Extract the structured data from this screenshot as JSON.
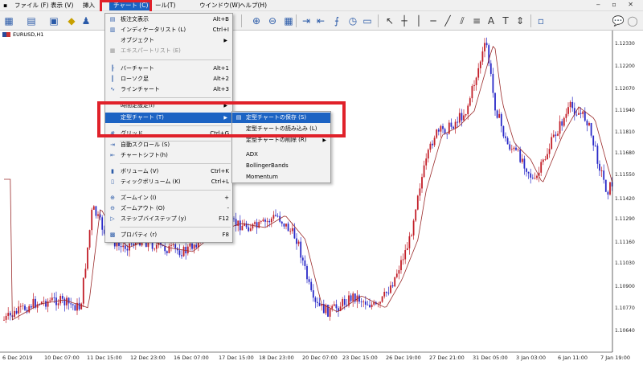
{
  "menubar": {
    "items": [
      {
        "label": "ファイル (F)"
      },
      {
        "label": "表示 (V)"
      },
      {
        "label": "挿入"
      },
      {
        "label": "チャート (C)"
      },
      {
        "label": "ール(T)"
      },
      {
        "label": "ウインドウ(W)"
      },
      {
        "label": "ヘルプ(H)"
      }
    ]
  },
  "symbol": "EURUSD,H1",
  "chart_menu": {
    "items": [
      {
        "label": "板注文表示",
        "shortcut": "Alt+B"
      },
      {
        "label": "インディケータリスト (L)",
        "shortcut": "Ctrl+I"
      },
      {
        "label": "オブジェクト",
        "shortcut": ""
      },
      {
        "label": "エキスパートリスト (E)",
        "shortcut": ""
      },
      {
        "label": "バーチャート",
        "shortcut": "Alt+1"
      },
      {
        "label": "ローソク足",
        "shortcut": "Alt+2"
      },
      {
        "label": "ラインチャート",
        "shortcut": "Alt+3"
      },
      {
        "label": "時間足設定(I)",
        "shortcut": ""
      },
      {
        "label": "定型チャート (T)",
        "shortcut": ""
      },
      {
        "label": "グリッド",
        "shortcut": "Ctrl+G"
      },
      {
        "label": "自動スクロール (S)",
        "shortcut": ""
      },
      {
        "label": "チャートシフト(h)",
        "shortcut": ""
      },
      {
        "label": "ボリューム (V)",
        "shortcut": "Ctrl+K"
      },
      {
        "label": "ティックボリューム (K)",
        "shortcut": "Ctrl+L"
      },
      {
        "label": "ズームイン (I)",
        "shortcut": "+"
      },
      {
        "label": "ズームアウト (O)",
        "shortcut": "-"
      },
      {
        "label": "ステップバイステップ (y)",
        "shortcut": "F12"
      },
      {
        "label": "プロパティ (r)",
        "shortcut": "F8"
      }
    ]
  },
  "submenu": {
    "items": [
      {
        "label": "定型チャートの保存 (S)"
      },
      {
        "label": "定型チャートの読み込み (L)"
      },
      {
        "label": "定型チャートの削除 (R)"
      },
      {
        "label": "ADX"
      },
      {
        "label": "BollingerBands"
      },
      {
        "label": "Momentum"
      }
    ]
  },
  "price_axis": [
    "1.12330",
    "1.12200",
    "1.12070",
    "1.11940",
    "1.11810",
    "1.11680",
    "1.11550",
    "1.11420",
    "1.11290",
    "1.11160",
    "1.11030",
    "1.10900",
    "1.10770",
    "1.10640"
  ],
  "time_axis": [
    "6 Dec 2019",
    "10 Dec 07:00",
    "11 Dec 15:00",
    "12 Dec 23:00",
    "16 Dec 07:00",
    "17 Dec 15:00",
    "18 Dec 23:00",
    "20 Dec 07:00",
    "23 Dec 15:00",
    "26 Dec 19:00",
    "27 Dec 21:00",
    "31 Dec 05:00",
    "3 Jan 03:00",
    "6 Jan 11:00",
    "7 Jan 19:00"
  ],
  "colors": {
    "bull": "#c21e28",
    "bear": "#2a2ac8",
    "ma": "#9a2a2a",
    "highlight": "#e0212a",
    "menu_selected": "#1c63c3"
  }
}
